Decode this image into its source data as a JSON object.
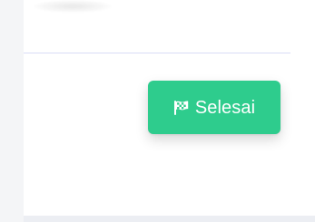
{
  "action": {
    "finish_label": "Selesai",
    "icon": "checkered-flag-icon"
  },
  "theme": {
    "accent": "#2ecc8d",
    "surface": "#ffffff",
    "divider": "#d9dcf6",
    "background": "#f4f5f7"
  }
}
